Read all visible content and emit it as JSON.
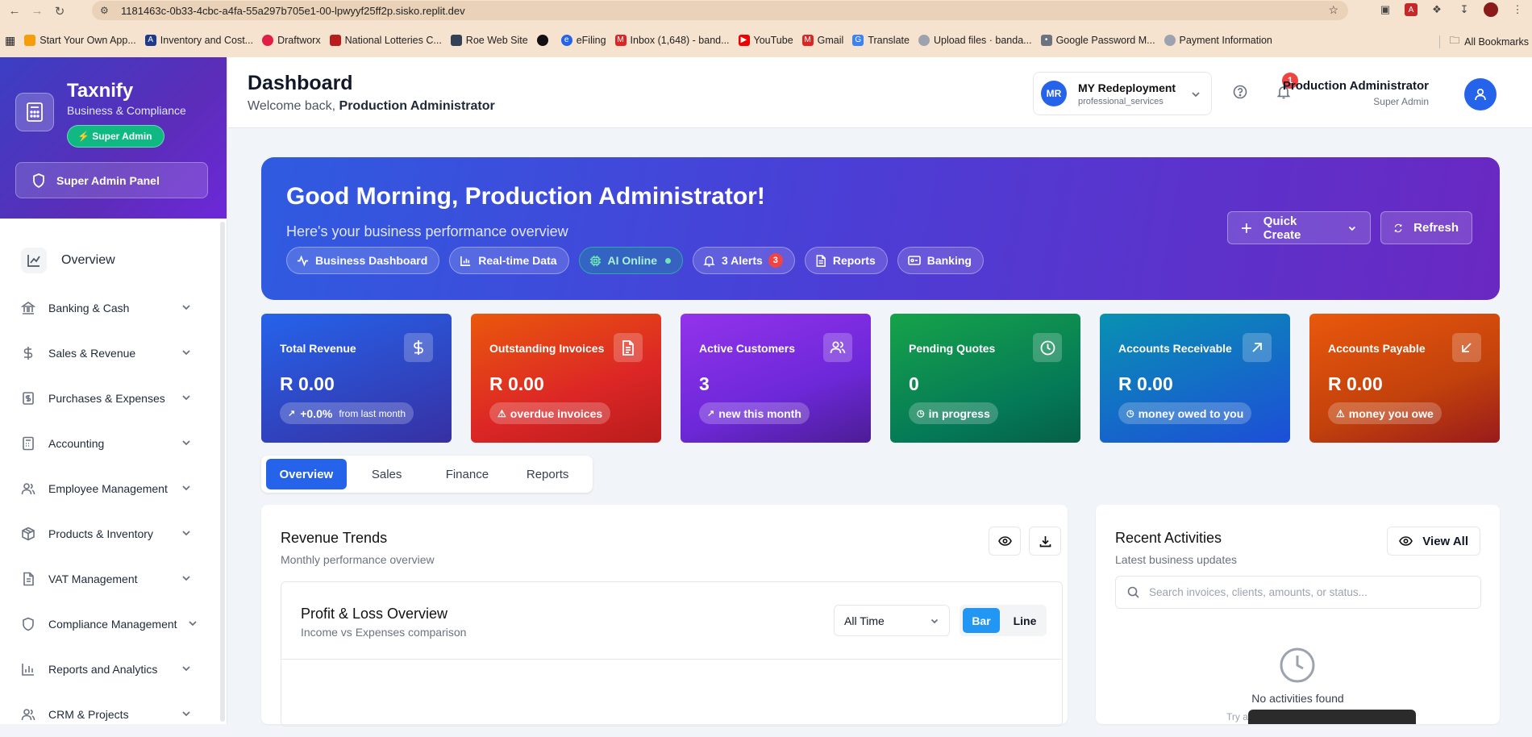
{
  "browser": {
    "url": "1181463c-0b33-4cbc-a4fa-55a297b705e1-00-lpwyyf25ff2p.sisko.replit.dev",
    "bookmarks": [
      "Start Your Own App...",
      "Inventory and Cost...",
      "Draftworx",
      "National Lotteries C...",
      "Roe Web Site",
      "",
      "eFiling",
      "Inbox (1,648) - band...",
      "YouTube",
      "Gmail",
      "Translate",
      "Upload files · banda...",
      "Google Password M...",
      "Payment Information"
    ],
    "all_bookmarks": "All Bookmarks"
  },
  "sidebar": {
    "brand": "Taxnify",
    "tagline": "Business & Compliance",
    "badge": "Super Admin",
    "panel": "Super Admin Panel",
    "overview": "Overview",
    "items": [
      {
        "label": "Banking & Cash",
        "icon": "bank-icon"
      },
      {
        "label": "Sales & Revenue",
        "icon": "dollar-icon"
      },
      {
        "label": "Purchases & Expenses",
        "icon": "receipt-icon"
      },
      {
        "label": "Accounting",
        "icon": "calculator-icon"
      },
      {
        "label": "Employee Management",
        "icon": "users-icon"
      },
      {
        "label": "Products & Inventory",
        "icon": "package-icon"
      },
      {
        "label": "VAT Management",
        "icon": "file-icon"
      },
      {
        "label": "Compliance Management",
        "icon": "shield-icon"
      },
      {
        "label": "Reports and Analytics",
        "icon": "bar-chart-icon"
      },
      {
        "label": "CRM & Projects",
        "icon": "users-icon"
      }
    ]
  },
  "header": {
    "title": "Dashboard",
    "welcome_prefix": "Welcome back, ",
    "welcome_name": "Production Administrator",
    "company_initials": "MR",
    "company_name": "MY Redeployment",
    "company_type": "professional_services",
    "notifications": "1",
    "user_name": "Production Administrator",
    "user_role": "Super Admin"
  },
  "hero": {
    "greeting": "Good Morning, Production Administrator!",
    "subtitle": "Here's your business performance overview",
    "chips": [
      "Business Dashboard",
      "Real-time Data",
      "AI Online",
      "3 Alerts",
      "Reports",
      "Banking"
    ],
    "alert_count": "3",
    "quick_create": "Quick Create",
    "refresh": "Refresh"
  },
  "cards": [
    {
      "label": "Total Revenue",
      "value": "R 0.00",
      "pill": "+0.0%",
      "pill_note": "from last month"
    },
    {
      "label": "Outstanding Invoices",
      "value": "R 0.00",
      "pill": "overdue invoices"
    },
    {
      "label": "Active Customers",
      "value": "3",
      "pill": "new this month"
    },
    {
      "label": "Pending Quotes",
      "value": "0",
      "pill": "in progress"
    },
    {
      "label": "Accounts Receivable",
      "value": "R 0.00",
      "pill": "money owed to you"
    },
    {
      "label": "Accounts Payable",
      "value": "R 0.00",
      "pill": "money you owe"
    }
  ],
  "tabs": [
    "Overview",
    "Sales",
    "Finance",
    "Reports"
  ],
  "revenue": {
    "title": "Revenue Trends",
    "subtitle": "Monthly performance overview",
    "pl_title": "Profit & Loss Overview",
    "pl_subtitle": "Income vs Expenses comparison",
    "period": "All Time",
    "bar": "Bar",
    "line": "Line"
  },
  "activities": {
    "title": "Recent Activities",
    "subtitle": "Latest business updates",
    "view_all": "View All",
    "search_placeholder": "Search invoices, clients, amounts, or status...",
    "empty": "No activities found",
    "try": "Try a"
  }
}
